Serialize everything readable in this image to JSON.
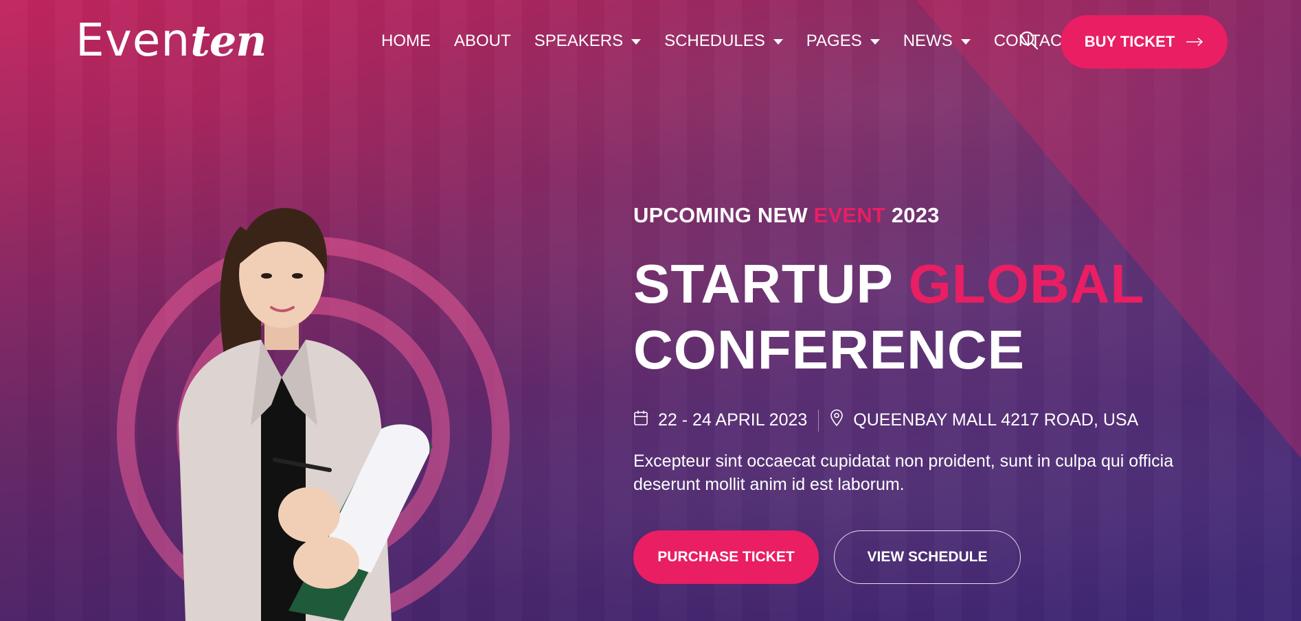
{
  "brand": {
    "logo_plain": "Even",
    "logo_script": "ten",
    "accent_color": "#e91e63"
  },
  "nav": {
    "items": [
      {
        "label": "HOME",
        "has_dropdown": false
      },
      {
        "label": "ABOUT",
        "has_dropdown": false
      },
      {
        "label": "SPEAKERS",
        "has_dropdown": true
      },
      {
        "label": "SCHEDULES",
        "has_dropdown": true
      },
      {
        "label": "PAGES",
        "has_dropdown": true
      },
      {
        "label": "NEWS",
        "has_dropdown": true
      },
      {
        "label": "CONTACT",
        "has_dropdown": false
      }
    ],
    "search_icon": "search-icon",
    "buy_ticket_label": "BUY TICKET",
    "buy_ticket_icon": "arrow-right-icon"
  },
  "hero": {
    "subtitle_prefix": "UPCOMING NEW",
    "subtitle_accent": "EVENT",
    "subtitle_suffix": "2023",
    "headline_line1_plain": "STARTUP",
    "headline_line1_accent": "GLOBAL",
    "headline_line2": "CONFERENCE",
    "date_icon": "calendar-icon",
    "date_text": "22 - 24 APRIL 2023",
    "location_icon": "location-pin-icon",
    "location_text": "QUEENBAY MALL 4217 ROAD, USA",
    "description": "Excepteur sint occaecat cupidatat non proident, sunt in culpa qui officia deserunt mollit anim id est laborum.",
    "primary_button": "PURCHASE TICKET",
    "secondary_button": "VIEW SCHEDULE"
  }
}
